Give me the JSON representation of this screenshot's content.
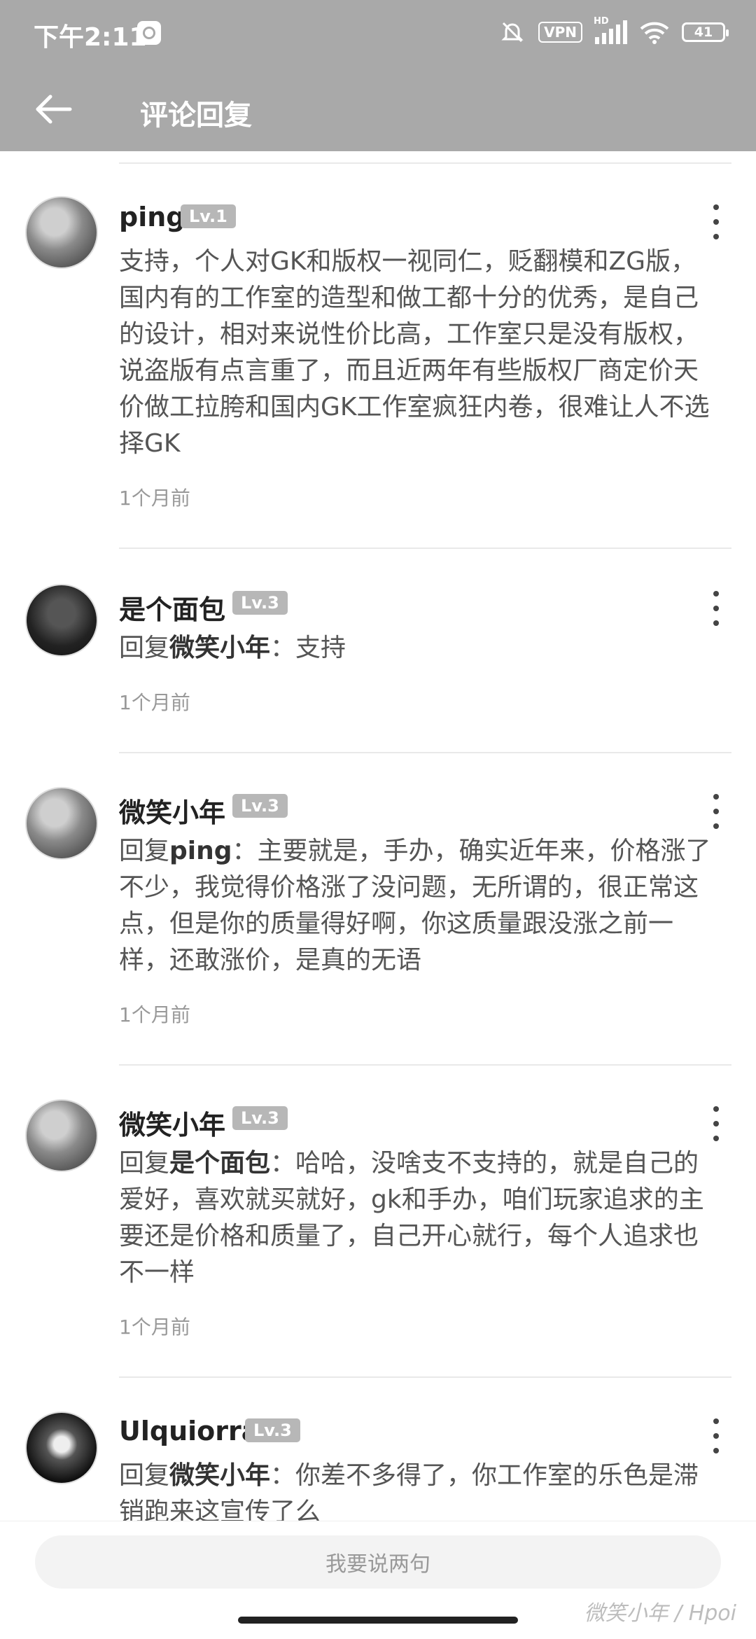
{
  "status_bar": {
    "time": "下午2:11",
    "vpn_label": "VPN",
    "hd_label": "HD",
    "battery": "41"
  },
  "app_bar": {
    "title": "评论回复",
    "back_icon": "arrow-left-icon"
  },
  "comments": [
    {
      "user": "ping",
      "level": "Lv.1",
      "text": "支持，个人对GK和版权一视同仁，贬翻模和ZG版，国内有的工作室的造型和做工都十分的优秀，是自己的设计，相对来说性价比高，工作室只是没有版权，说盗版有点言重了，而且近两年有些版权厂商定价天价做工拉胯和国内GK工作室疯狂内卷，很难让人不选择GK",
      "time": "1个月前"
    },
    {
      "user": "是个面包",
      "level": "Lv.3",
      "reply_prefix": "回复",
      "reply_to": "微笑小年",
      "text": "：支持",
      "time": "1个月前"
    },
    {
      "user": "微笑小年",
      "level": "Lv.3",
      "reply_prefix": "回复",
      "reply_to": "ping",
      "text": "：主要就是，手办，确实近年来，价格涨了不少，我觉得价格涨了没问题，无所谓的，很正常这点，但是你的质量得好啊，你这质量跟没涨之前一样，还敢涨价，是真的无语",
      "time": "1个月前"
    },
    {
      "user": "微笑小年",
      "level": "Lv.3",
      "reply_prefix": "回复",
      "reply_to": "是个面包",
      "text": "：哈哈，没啥支不支持的，就是自己的爱好，喜欢就买就好，gk和手办，咱们玩家追求的主要还是价格和质量了，自己开心就行，每个人追求也不一样",
      "time": "1个月前"
    },
    {
      "user": "Ulquiorra",
      "level": "Lv.3",
      "reply_prefix": "回复",
      "reply_to": "微笑小年",
      "text": "：你差不多得了，你工作室的乐色是滞销跑来这宣传了么"
    }
  ],
  "input": {
    "placeholder": "我要说两句"
  },
  "watermark": "微笑小年 / Hpoi"
}
